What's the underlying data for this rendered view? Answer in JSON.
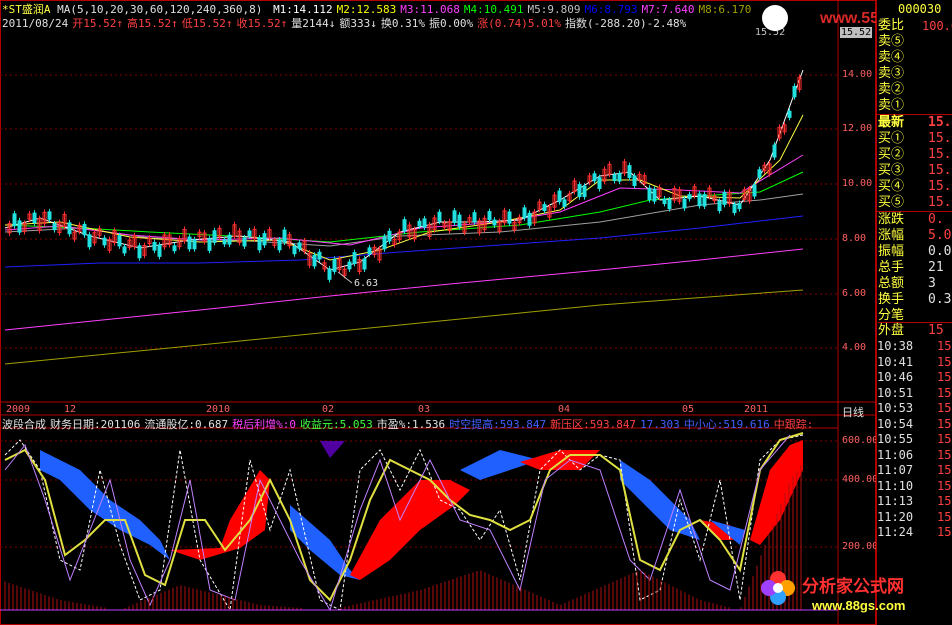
{
  "stock": {
    "title": "*ST盛润A",
    "ma_line": "MA(5,10,20,30,60,120,240,360,8)",
    "ma_values": [
      {
        "label": "M1:14.112",
        "color": "#ffffff"
      },
      {
        "label": "M2:12.583",
        "color": "#ffff00"
      },
      {
        "label": "M3:11.068",
        "color": "#ff40ff"
      },
      {
        "label": "M4:10.491",
        "color": "#00ff00"
      },
      {
        "label": "M5:9.809",
        "color": "#c0c0c0"
      },
      {
        "label": "M6:8.793",
        "color": "#0000ff"
      },
      {
        "label": "M7:7.640",
        "color": "#ff40ff"
      },
      {
        "label": "M8:6.170",
        "color": "#a0a000"
      }
    ],
    "code": "000030",
    "date": "2011/08/24",
    "open": "开15.52↑",
    "high": "高15.52↑",
    "low": "低15.52↑",
    "close": "收15.52↑",
    "volume": "量2144↓",
    "amount": "额333↓",
    "turnover": "换0.31%",
    "amplitude": "振0.00%",
    "change": "涨(0.74)5.01%",
    "index": "指数(-288.20)-2.48%",
    "price_tag": "15.52",
    "min_label": "6.63",
    "watermark": "www.551..."
  },
  "indicator": {
    "name": "波段合成",
    "report_date": "财务日期:201106",
    "float_shares": "流通股亿:0.687",
    "profit_growth": "税后利增%:0",
    "eps": "收益元:5.053",
    "pe": "市盈%:1.536",
    "zone1": "时空提高:593.847",
    "zone2": "新压区:593.847",
    "val3": "17.303",
    "zone4": "中小心:519.616",
    "zone5": "中跟踪:"
  },
  "y_axis_price": [
    "14.00",
    "12.00",
    "10.00",
    "8.00",
    "6.00",
    "4.00"
  ],
  "y_axis_ind": [
    "600.00",
    "400.00",
    "200.00"
  ],
  "x_axis": [
    "2009",
    "12",
    "2010",
    "02",
    "03",
    "04",
    "05",
    "2011",
    "日线"
  ],
  "orderbook": {
    "top_label": "委比",
    "top_value": "100.00",
    "asks": [
      "卖⑤",
      "卖④",
      "卖③",
      "卖②",
      "卖①"
    ],
    "latest_label": "最新",
    "latest_value": "15.",
    "bids": [
      {
        "label": "买①",
        "value": "15."
      },
      {
        "label": "买②",
        "value": "15."
      },
      {
        "label": "买③",
        "value": "15."
      },
      {
        "label": "买④",
        "value": "15."
      },
      {
        "label": "买⑤",
        "value": "15."
      }
    ],
    "stats": [
      {
        "label": "涨跌",
        "value": "0."
      },
      {
        "label": "涨幅",
        "value": "5.0"
      },
      {
        "label": "振幅",
        "value": "0.00"
      },
      {
        "label": "总手",
        "value": "21"
      },
      {
        "label": "总额",
        "value": "3"
      },
      {
        "label": "换手",
        "value": "0.3"
      },
      {
        "label": "分笔",
        "value": ""
      }
    ],
    "outer_label": "外盘",
    "outer_value": "15"
  },
  "ticks": [
    {
      "time": "10:38",
      "val": "15"
    },
    {
      "time": "10:41",
      "val": "15"
    },
    {
      "time": "10:46",
      "val": "15"
    },
    {
      "time": "10:51",
      "val": "15"
    },
    {
      "time": "10:53",
      "val": "15"
    },
    {
      "time": "10:54",
      "val": "15"
    },
    {
      "time": "10:55",
      "val": "15"
    },
    {
      "time": "11:06",
      "val": "15"
    },
    {
      "time": "11:07",
      "val": "15"
    },
    {
      "time": "11:10",
      "val": "15"
    },
    {
      "time": "11:13",
      "val": "15"
    },
    {
      "time": "11:20",
      "val": "15"
    },
    {
      "time": "11:24",
      "val": "15"
    }
  ],
  "logo": {
    "name": "分析家公式网",
    "url": "www.88gs.com"
  }
}
